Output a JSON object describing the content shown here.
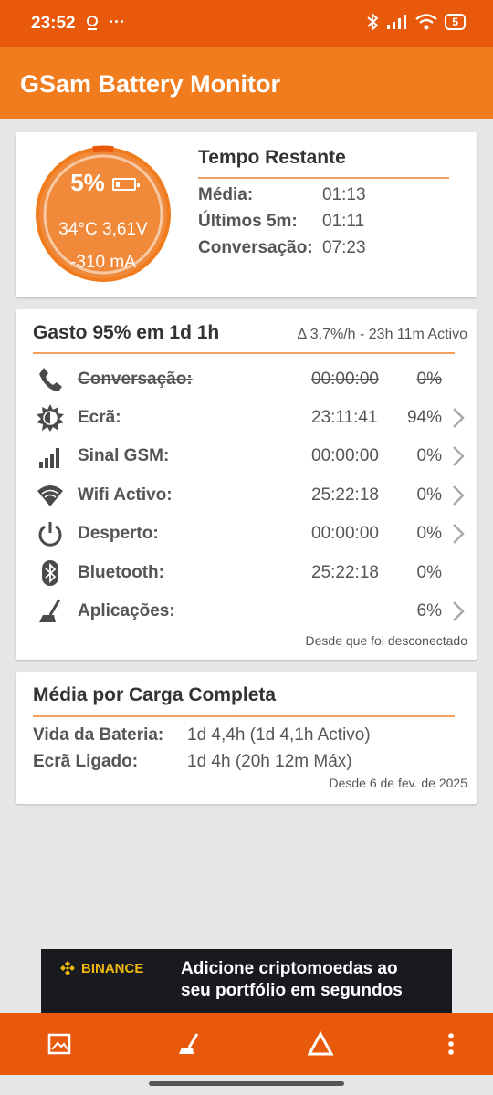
{
  "status_bar": {
    "time": "23:52",
    "left_icons": [
      "location-icon",
      "more-dots-icon"
    ],
    "right_icons": [
      "bluetooth-icon",
      "signal-icon",
      "wifi-icon"
    ],
    "battery_level": "5"
  },
  "app_bar": {
    "title": "GSam Battery Monitor"
  },
  "battery_gauge": {
    "percent": "5%",
    "level_fraction": 0.05,
    "temp_voltage": "34°C  3,61V",
    "current": "-310 mA"
  },
  "time_remaining": {
    "title": "Tempo Restante",
    "rows": [
      {
        "label": "Média:",
        "value": "01:13"
      },
      {
        "label": "Últimos 5m:",
        "value": "01:11"
      },
      {
        "label": "Conversação:",
        "value": "07:23"
      }
    ]
  },
  "usage": {
    "title": "Gasto 95% em 1d 1h",
    "delta": "Δ 3,7%/h - 23h 11m Activo",
    "rows": [
      {
        "icon": "phone-icon",
        "label": "Conversação:",
        "time": "00:00:00",
        "pct": "0%",
        "strike": true,
        "chevron": false
      },
      {
        "icon": "screen-brightness-icon",
        "label": "Ecrã:",
        "time": "23:11:41",
        "pct": "94%",
        "strike": false,
        "chevron": true
      },
      {
        "icon": "signal-bars-icon",
        "label": "Sinal GSM:",
        "time": "00:00:00",
        "pct": "0%",
        "strike": false,
        "chevron": true
      },
      {
        "icon": "wifi-icon",
        "label": "Wifi Activo:",
        "time": "25:22:18",
        "pct": "0%",
        "strike": false,
        "chevron": true
      },
      {
        "icon": "power-icon",
        "label": "Desperto:",
        "time": "00:00:00",
        "pct": "0%",
        "strike": false,
        "chevron": true
      },
      {
        "icon": "bluetooth-icon",
        "label": "Bluetooth:",
        "time": "25:22:18",
        "pct": "0%",
        "strike": false,
        "chevron": false
      },
      {
        "icon": "broom-icon",
        "label": "Aplicações:",
        "time": "",
        "pct": "6%",
        "strike": false,
        "chevron": true
      }
    ],
    "footer": "Desde que foi desconectado"
  },
  "full_charge": {
    "title": "Média por Carga Completa",
    "rows": [
      {
        "label": "Vida da Bateria:",
        "value": "1d 4,4h (1d 4,1h Activo)"
      },
      {
        "label": "Ecrã Ligado:",
        "value": "1d 4h (20h 12m Máx)"
      }
    ],
    "footer": "Desde 6 de fev. de 2025"
  },
  "ad": {
    "brand": "BINANCE",
    "text_line1": "Adicione criptomoedas ao",
    "text_line2": "seu portfólio em segundos"
  },
  "bottom_bar": {
    "icons": [
      "image-icon",
      "broom-icon",
      "delta-icon",
      "overflow-menu-icon"
    ]
  },
  "colors": {
    "status_bar": "#e8590c",
    "app_bar": "#f07c1d",
    "accent": "#f07c1d",
    "gauge_fill": "#f0893a",
    "gauge_ring": "#f7c9a3"
  }
}
